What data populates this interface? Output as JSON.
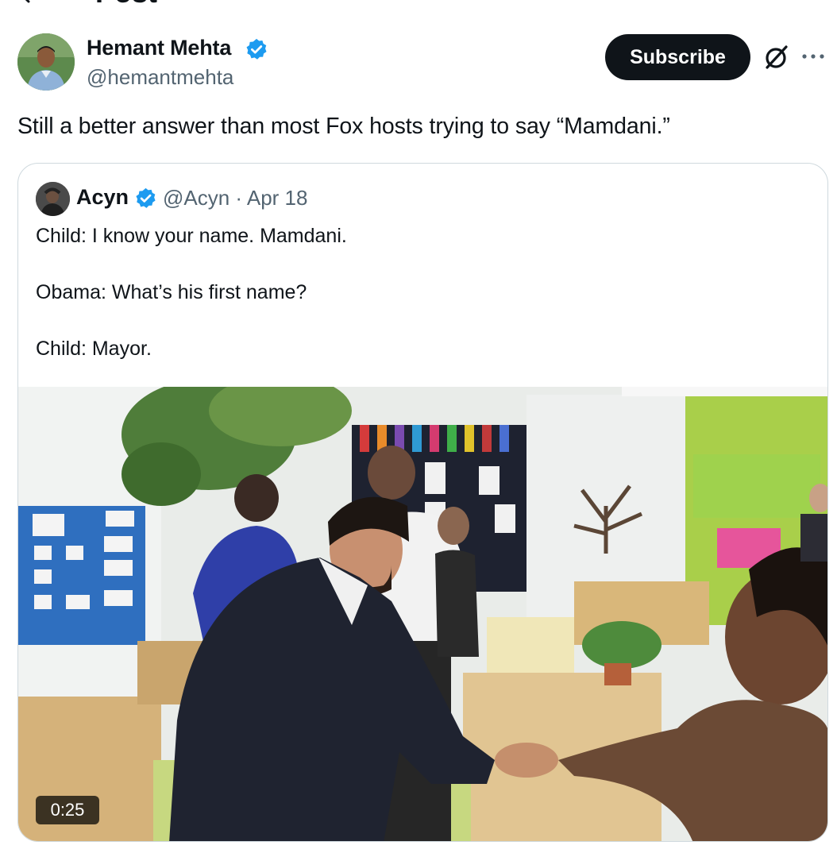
{
  "header": {
    "title": "Post",
    "back_icon": "back-arrow-icon"
  },
  "author": {
    "name": "Hemant Mehta",
    "handle": "@hemantmehta",
    "verified": true
  },
  "actions": {
    "subscribe_label": "Subscribe",
    "grok_icon": "grok-icon",
    "more_icon": "more-icon"
  },
  "post": {
    "text": "Still a better answer than most Fox hosts trying to say “Mamdani.”"
  },
  "quote": {
    "name": "Acyn",
    "meta": "@Acyn · Apr 18",
    "verified": true,
    "lines": [
      "Child: I know your name. Mamdani.",
      "Obama: What’s his first name?",
      "Child: Mayor."
    ],
    "video_duration": "0:25"
  },
  "colors": {
    "text_primary": "#0f1419",
    "text_secondary": "#536471",
    "verified_blue": "#1d9bf0",
    "border": "#cfd9de",
    "button_bg": "#0f1419"
  }
}
